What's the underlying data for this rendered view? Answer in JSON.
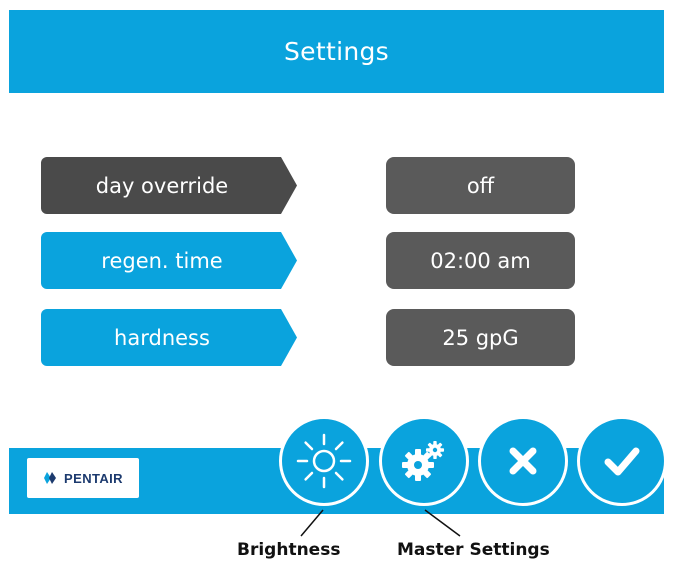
{
  "header": {
    "title": "Settings"
  },
  "settings_rows": [
    {
      "label": "day override",
      "value": "off",
      "selected": true
    },
    {
      "label": "regen. time",
      "value": "02:00 am",
      "selected": false
    },
    {
      "label": "hardness",
      "value": "25 gpG",
      "selected": false
    }
  ],
  "brand": {
    "name": "PENTAIR"
  },
  "buttons": [
    {
      "icon": "sun-icon"
    },
    {
      "icon": "gears-icon"
    },
    {
      "icon": "close-icon"
    },
    {
      "icon": "checkmark-icon"
    }
  ],
  "annotations": {
    "brightness": "Brightness",
    "master_settings": "Master Settings"
  },
  "colors": {
    "accent": "#0aa3dd",
    "dark_label": "#4a4a4a",
    "value_box": "#5a5a5a",
    "brand_navy": "#1c3a6e"
  }
}
